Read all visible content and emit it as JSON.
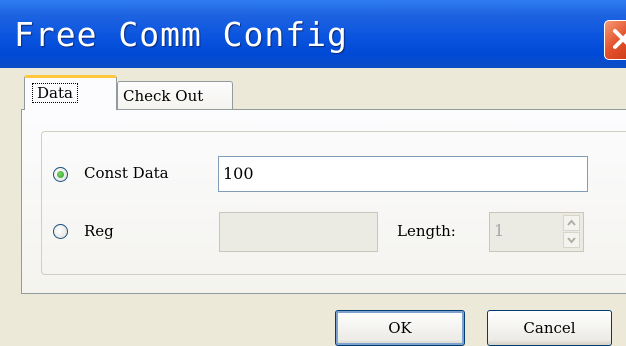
{
  "window": {
    "title": "Free Comm Config"
  },
  "tabs": [
    {
      "label": "Data",
      "active": true
    },
    {
      "label": "Check Out",
      "active": false
    }
  ],
  "data_tab": {
    "const_data": {
      "label": "Const Data",
      "selected": true,
      "value": "100"
    },
    "reg": {
      "label": "Reg",
      "selected": false,
      "value": ""
    },
    "length": {
      "label": "Length:",
      "value": "1"
    }
  },
  "buttons": {
    "ok": "OK",
    "cancel": "Cancel"
  },
  "colors": {
    "title_bar": "#0a54df",
    "close_button": "#e2502a",
    "radio_selected": "#21a121",
    "dialog_bg": "#ece9d8"
  },
  "icons": {
    "close": "close-icon",
    "spin_up": "chevron-up-icon",
    "spin_down": "chevron-down-icon"
  }
}
